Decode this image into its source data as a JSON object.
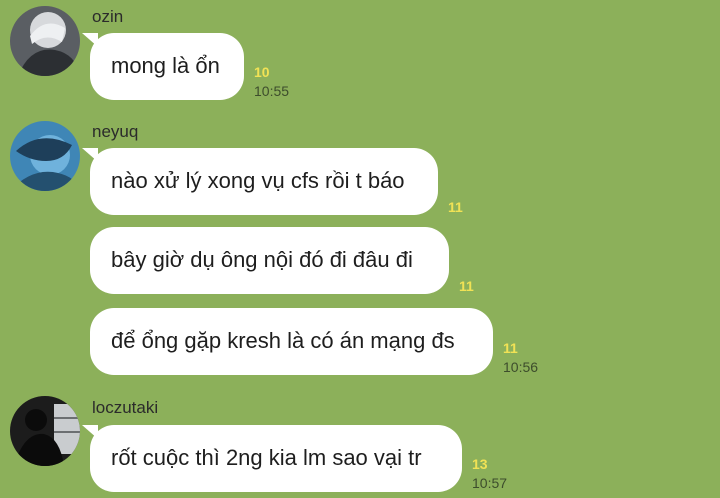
{
  "messages": [
    {
      "sender": "ozin",
      "avatar": "avatar-ozin",
      "bubbles": [
        {
          "text": "mong là ổn",
          "read_count": "10",
          "time": "10:55"
        }
      ]
    },
    {
      "sender": "neyuq",
      "avatar": "avatar-neyuq",
      "bubbles": [
        {
          "text": "nào xử lý xong vụ cfs rồi t báo",
          "read_count": "11",
          "time": ""
        },
        {
          "text": "bây giờ dụ ông nội đó đi đâu đi",
          "read_count": "11",
          "time": ""
        },
        {
          "text": "để ổng gặp kresh là có án mạng đs",
          "read_count": "11",
          "time": "10:56"
        }
      ]
    },
    {
      "sender": "loczutaki",
      "avatar": "avatar-loczutaki",
      "bubbles": [
        {
          "text": "rốt cuộc thì 2ng kia lm sao vại tr",
          "read_count": "13",
          "time": "10:57"
        }
      ]
    }
  ],
  "colors": {
    "background": "#8cb05a",
    "bubble": "#ffffff",
    "read_count": "#f1e255",
    "timestamp": "#3d4d2c"
  }
}
